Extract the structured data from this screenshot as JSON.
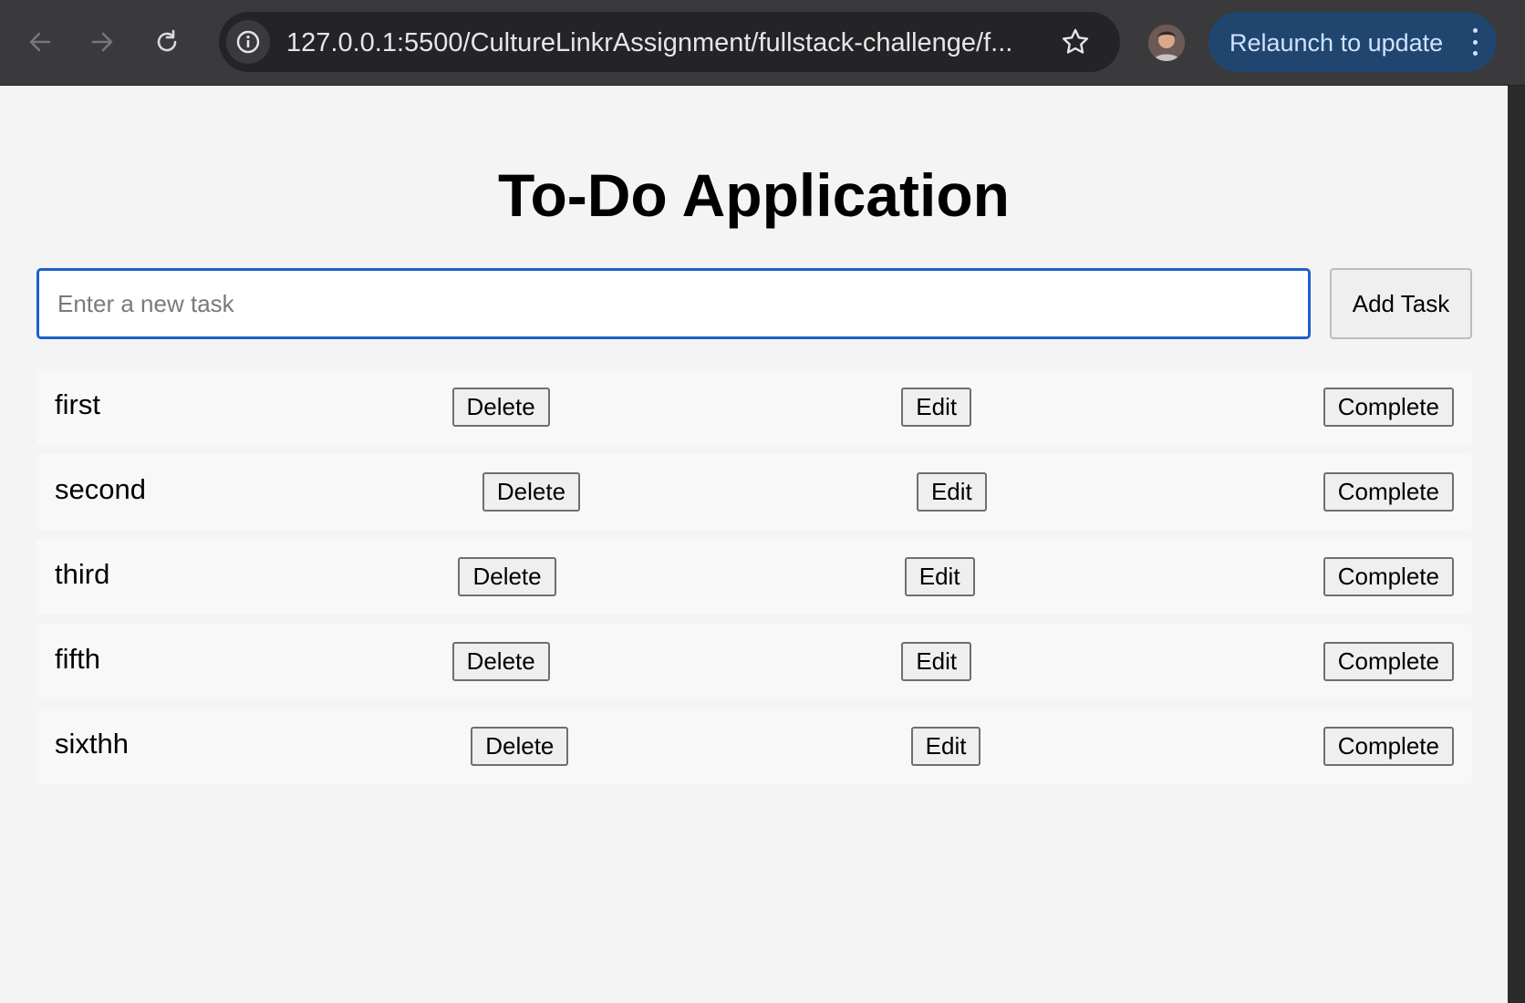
{
  "browser": {
    "url": "127.0.0.1:5500/CultureLinkrAssignment/fullstack-challenge/f...",
    "relaunch_label": "Relaunch to update",
    "icons": [
      "back-arrow-icon",
      "forward-arrow-icon",
      "reload-icon",
      "site-info-icon",
      "bookmark-star-icon",
      "profile-avatar",
      "more-menu-icon"
    ],
    "accent_color": "#20466f"
  },
  "app": {
    "title": "To-Do Application",
    "input_placeholder": "Enter a new task",
    "input_value": "",
    "add_button_label": "Add Task",
    "focus_color": "#1d5fc9"
  },
  "tasks": [
    {
      "text": "first",
      "delete_label": "Delete",
      "edit_label": "Edit",
      "complete_label": "Complete"
    },
    {
      "text": "second",
      "delete_label": "Delete",
      "edit_label": "Edit",
      "complete_label": "Complete"
    },
    {
      "text": "third",
      "delete_label": "Delete",
      "edit_label": "Edit",
      "complete_label": "Complete"
    },
    {
      "text": "fifth",
      "delete_label": "Delete",
      "edit_label": "Edit",
      "complete_label": "Complete"
    },
    {
      "text": "sixthh",
      "delete_label": "Delete",
      "edit_label": "Edit",
      "complete_label": "Complete"
    }
  ]
}
